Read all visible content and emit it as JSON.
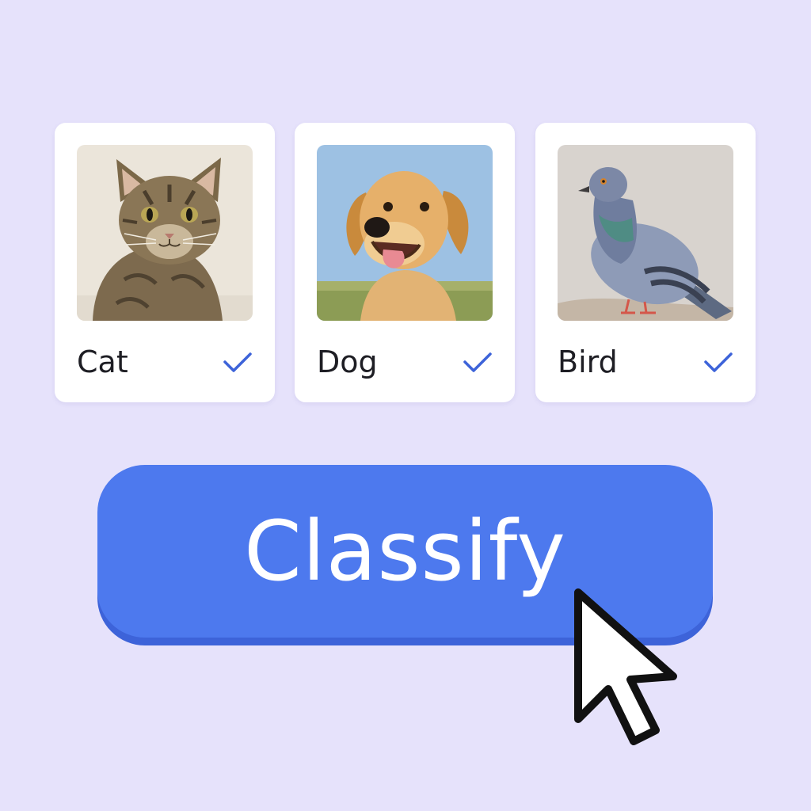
{
  "cards": [
    {
      "label": "Cat",
      "image": "tabby-cat-photo",
      "selected": true
    },
    {
      "label": "Dog",
      "image": "golden-retriever-photo",
      "selected": true
    },
    {
      "label": "Bird",
      "image": "pigeon-photo",
      "selected": true
    }
  ],
  "classify_button": {
    "label": "Classify"
  },
  "colors": {
    "background": "#e6e2fb",
    "card": "#ffffff",
    "accent": "#4d79ee",
    "check": "#3d63d9",
    "text": "#1e1e24"
  },
  "icons": {
    "check": "check-icon",
    "cursor": "mouse-pointer-icon"
  }
}
